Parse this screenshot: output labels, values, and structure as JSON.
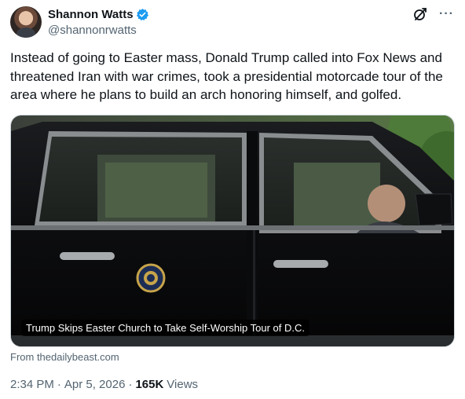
{
  "author": {
    "display_name": "Shannon Watts",
    "handle": "@shannonrwatts",
    "avatar_icon": "avatar-photo",
    "verified_icon": "verified-badge-icon",
    "verified_color": "#1d9bf0"
  },
  "header_icons": {
    "grok": "grok-icon",
    "more": "more-icon",
    "more_glyph": "···"
  },
  "tweet": {
    "text": "Instead of going to Easter mass, Donald Trump called into Fox News and threatened Iran with war crimes, took a presidential motorcade tour of the area where he plans to build an arch honoring himself, and golfed."
  },
  "card": {
    "caption": "Trump Skips Easter Church to Take Self-Worship Tour of D.C.",
    "source": "From thedailybeast.com"
  },
  "meta": {
    "time": "2:34 PM",
    "separator": "·",
    "date": "Apr 5, 2026",
    "views_count": "165K",
    "views_label": "Views"
  },
  "colors": {
    "text_primary": "#0f1419",
    "text_secondary": "#536471",
    "accent": "#1d9bf0",
    "border": "#cfd9de"
  }
}
